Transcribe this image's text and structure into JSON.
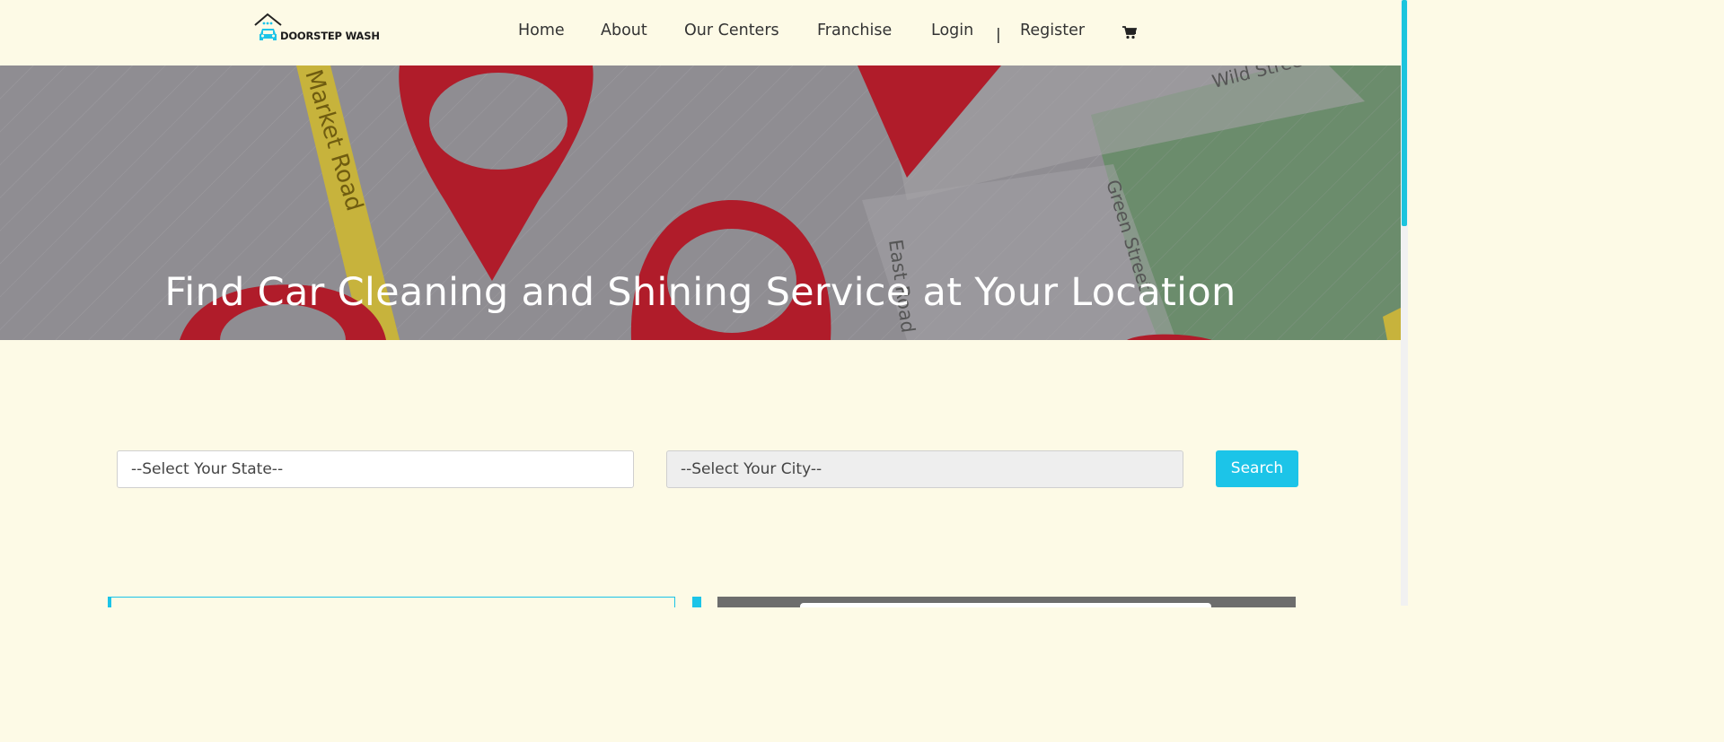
{
  "brand": {
    "name": "DOORSTEP WASH",
    "accent": "#1cc4e8"
  },
  "nav": {
    "items": [
      "Home",
      "About",
      "Our Centers",
      "Franchise",
      "Login",
      "Register"
    ],
    "separator": "|",
    "cart_icon": "cart-icon"
  },
  "hero": {
    "title": "Find Car Cleaning and Shining Service at Your Location",
    "map_labels": [
      "Market Road",
      "East Road",
      "Green Street",
      "Wild Street"
    ]
  },
  "search": {
    "state_value": "--Select Your State--",
    "city_value": "--Select Your City--",
    "button_label": "Search"
  }
}
